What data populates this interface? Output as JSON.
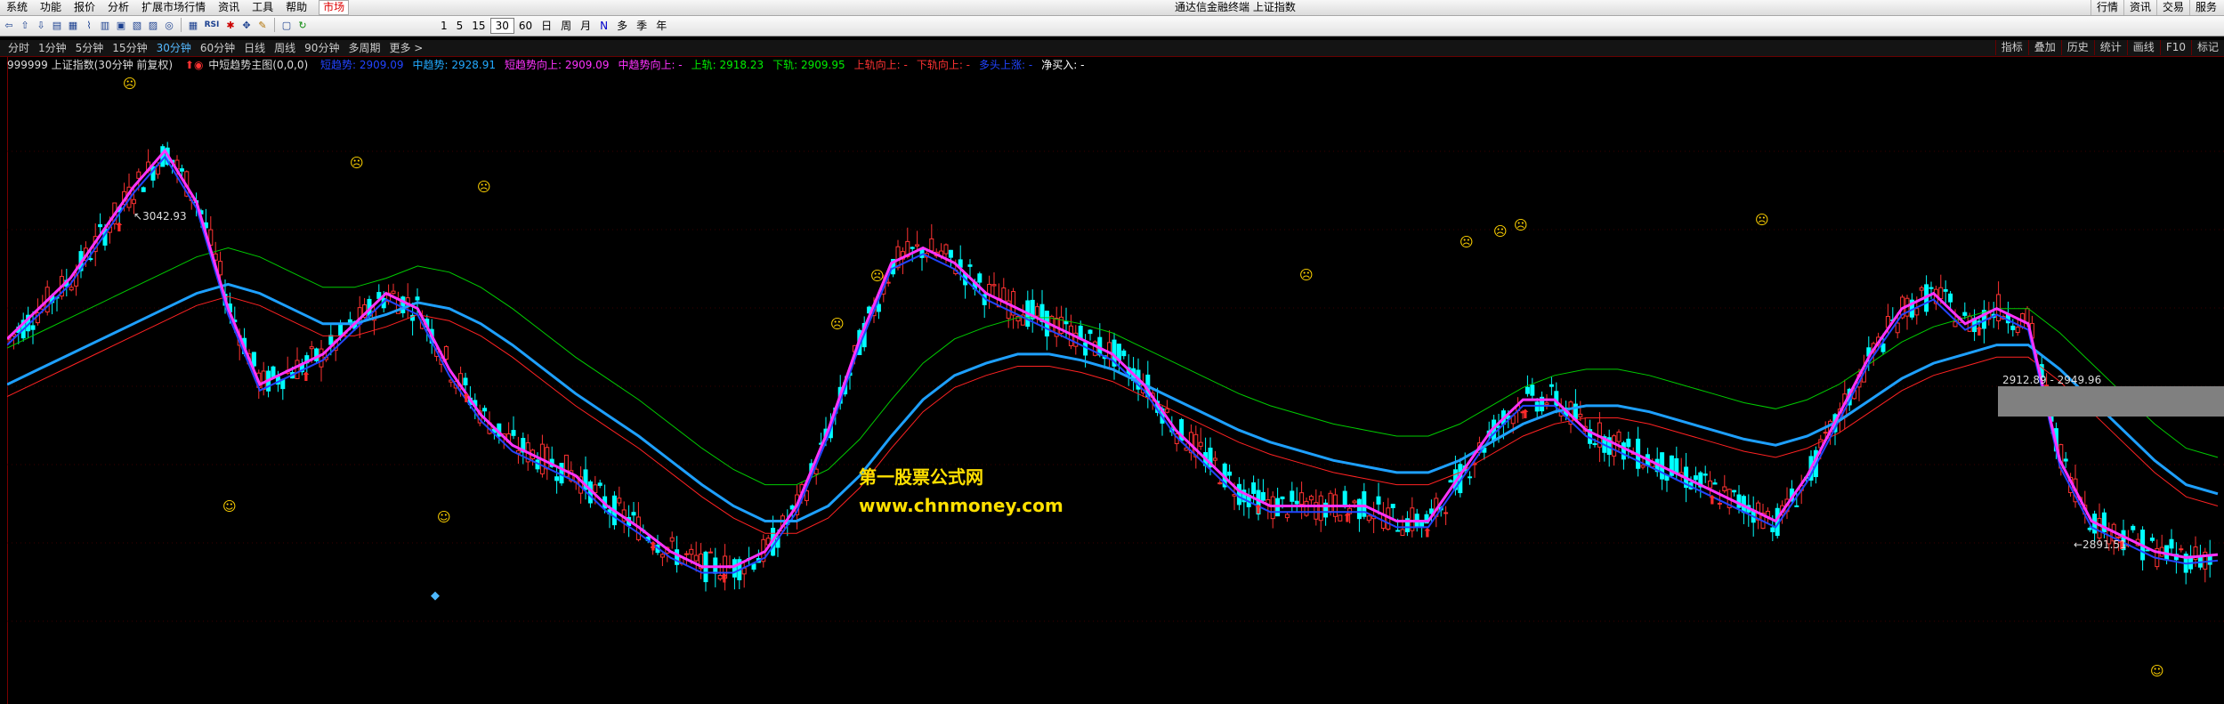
{
  "menubar": {
    "items": [
      "系统",
      "功能",
      "报价",
      "分析",
      "扩展市场行情",
      "资讯",
      "工具",
      "帮助"
    ],
    "market": "市场",
    "title": "通达信金融终端  上证指数",
    "right": [
      "行情",
      "资讯",
      "交易",
      "服务"
    ]
  },
  "toolbar": {
    "periods": [
      "1",
      "5",
      "15",
      "30",
      "60",
      "日",
      "周",
      "月",
      "N",
      "多",
      "季",
      "年"
    ],
    "selected_period": "30",
    "rsi_label": "RSI"
  },
  "tabs": {
    "items": [
      "分时",
      "1分钟",
      "5分钟",
      "15分钟",
      "30分钟",
      "60分钟",
      "日线",
      "周线",
      "90分钟",
      "多周期",
      "更多 >"
    ],
    "selected": "30分钟",
    "right": [
      "指标",
      "叠加",
      "历史",
      "统计",
      "画线",
      "F10",
      "标记"
    ]
  },
  "legend": {
    "security": "999999 上证指数(30分钟 前复权)",
    "indicator": "中短趋势主图(0,0,0)",
    "fields": [
      {
        "text": "短趋势: 2909.09",
        "color": "#2244ff"
      },
      {
        "text": "中趋势: 2928.91",
        "color": "#22aaff"
      },
      {
        "text": "短趋势向上: 2909.09",
        "color": "#ff33ff"
      },
      {
        "text": "中趋势向上: -",
        "color": "#ff33ff"
      },
      {
        "text": "上轨: 2918.23",
        "color": "#00ee00"
      },
      {
        "text": "下轨: 2909.95",
        "color": "#00ee00"
      },
      {
        "text": "上轨向上: -",
        "color": "#ff3333"
      },
      {
        "text": "下轨向上: -",
        "color": "#ff3333"
      },
      {
        "text": "多头上涨: -",
        "color": "#2244ff"
      },
      {
        "text": "净买入: -",
        "color": "#ffffff"
      }
    ]
  },
  "annotations": {
    "high_label": "3042.93",
    "low_label": "←2891.51",
    "range_label": "2912.89 - 2949.96"
  },
  "watermark": {
    "line1": "第一股票公式网",
    "line2": "www.chnmoney.com"
  },
  "colors": {
    "up": "#ff3232",
    "down": "#00ffff",
    "short_trend": "#ff33ff",
    "mid_trend": "#1ea0ff",
    "upper_band": "#00cc00",
    "lower_band": "#ff2222"
  },
  "chart_data": {
    "type": "candlestick",
    "price_range": [
      2880,
      3050
    ],
    "series": [
      {
        "name": "短趋势",
        "values": [
          2980,
          2990,
          3000,
          3015,
          3030,
          3042,
          3025,
          2990,
          2965,
          2970,
          2975,
          2985,
          2995,
          2990,
          2970,
          2955,
          2945,
          2940,
          2935,
          2925,
          2918,
          2910,
          2905,
          2905,
          2910,
          2925,
          2950,
          2980,
          3005,
          3010,
          3005,
          2995,
          2990,
          2985,
          2980,
          2975,
          2965,
          2950,
          2940,
          2930,
          2925,
          2925,
          2925,
          2925,
          2920,
          2920,
          2935,
          2950,
          2960,
          2960,
          2950,
          2945,
          2940,
          2935,
          2930,
          2925,
          2920,
          2935,
          2955,
          2975,
          2990,
          2995,
          2985,
          2990,
          2985,
          2940,
          2920,
          2915,
          2910,
          2908,
          2909
        ]
      },
      {
        "name": "中趋势",
        "values": [
          2965,
          2970,
          2975,
          2980,
          2985,
          2990,
          2995,
          2998,
          2995,
          2990,
          2985,
          2985,
          2988,
          2992,
          2990,
          2985,
          2978,
          2970,
          2962,
          2955,
          2948,
          2940,
          2932,
          2925,
          2920,
          2920,
          2925,
          2935,
          2948,
          2960,
          2968,
          2972,
          2975,
          2975,
          2973,
          2970,
          2965,
          2960,
          2955,
          2950,
          2946,
          2943,
          2940,
          2938,
          2936,
          2936,
          2940,
          2946,
          2952,
          2956,
          2958,
          2958,
          2956,
          2953,
          2950,
          2947,
          2945,
          2948,
          2953,
          2960,
          2967,
          2972,
          2975,
          2978,
          2978,
          2970,
          2960,
          2950,
          2940,
          2932,
          2929
        ]
      }
    ]
  }
}
